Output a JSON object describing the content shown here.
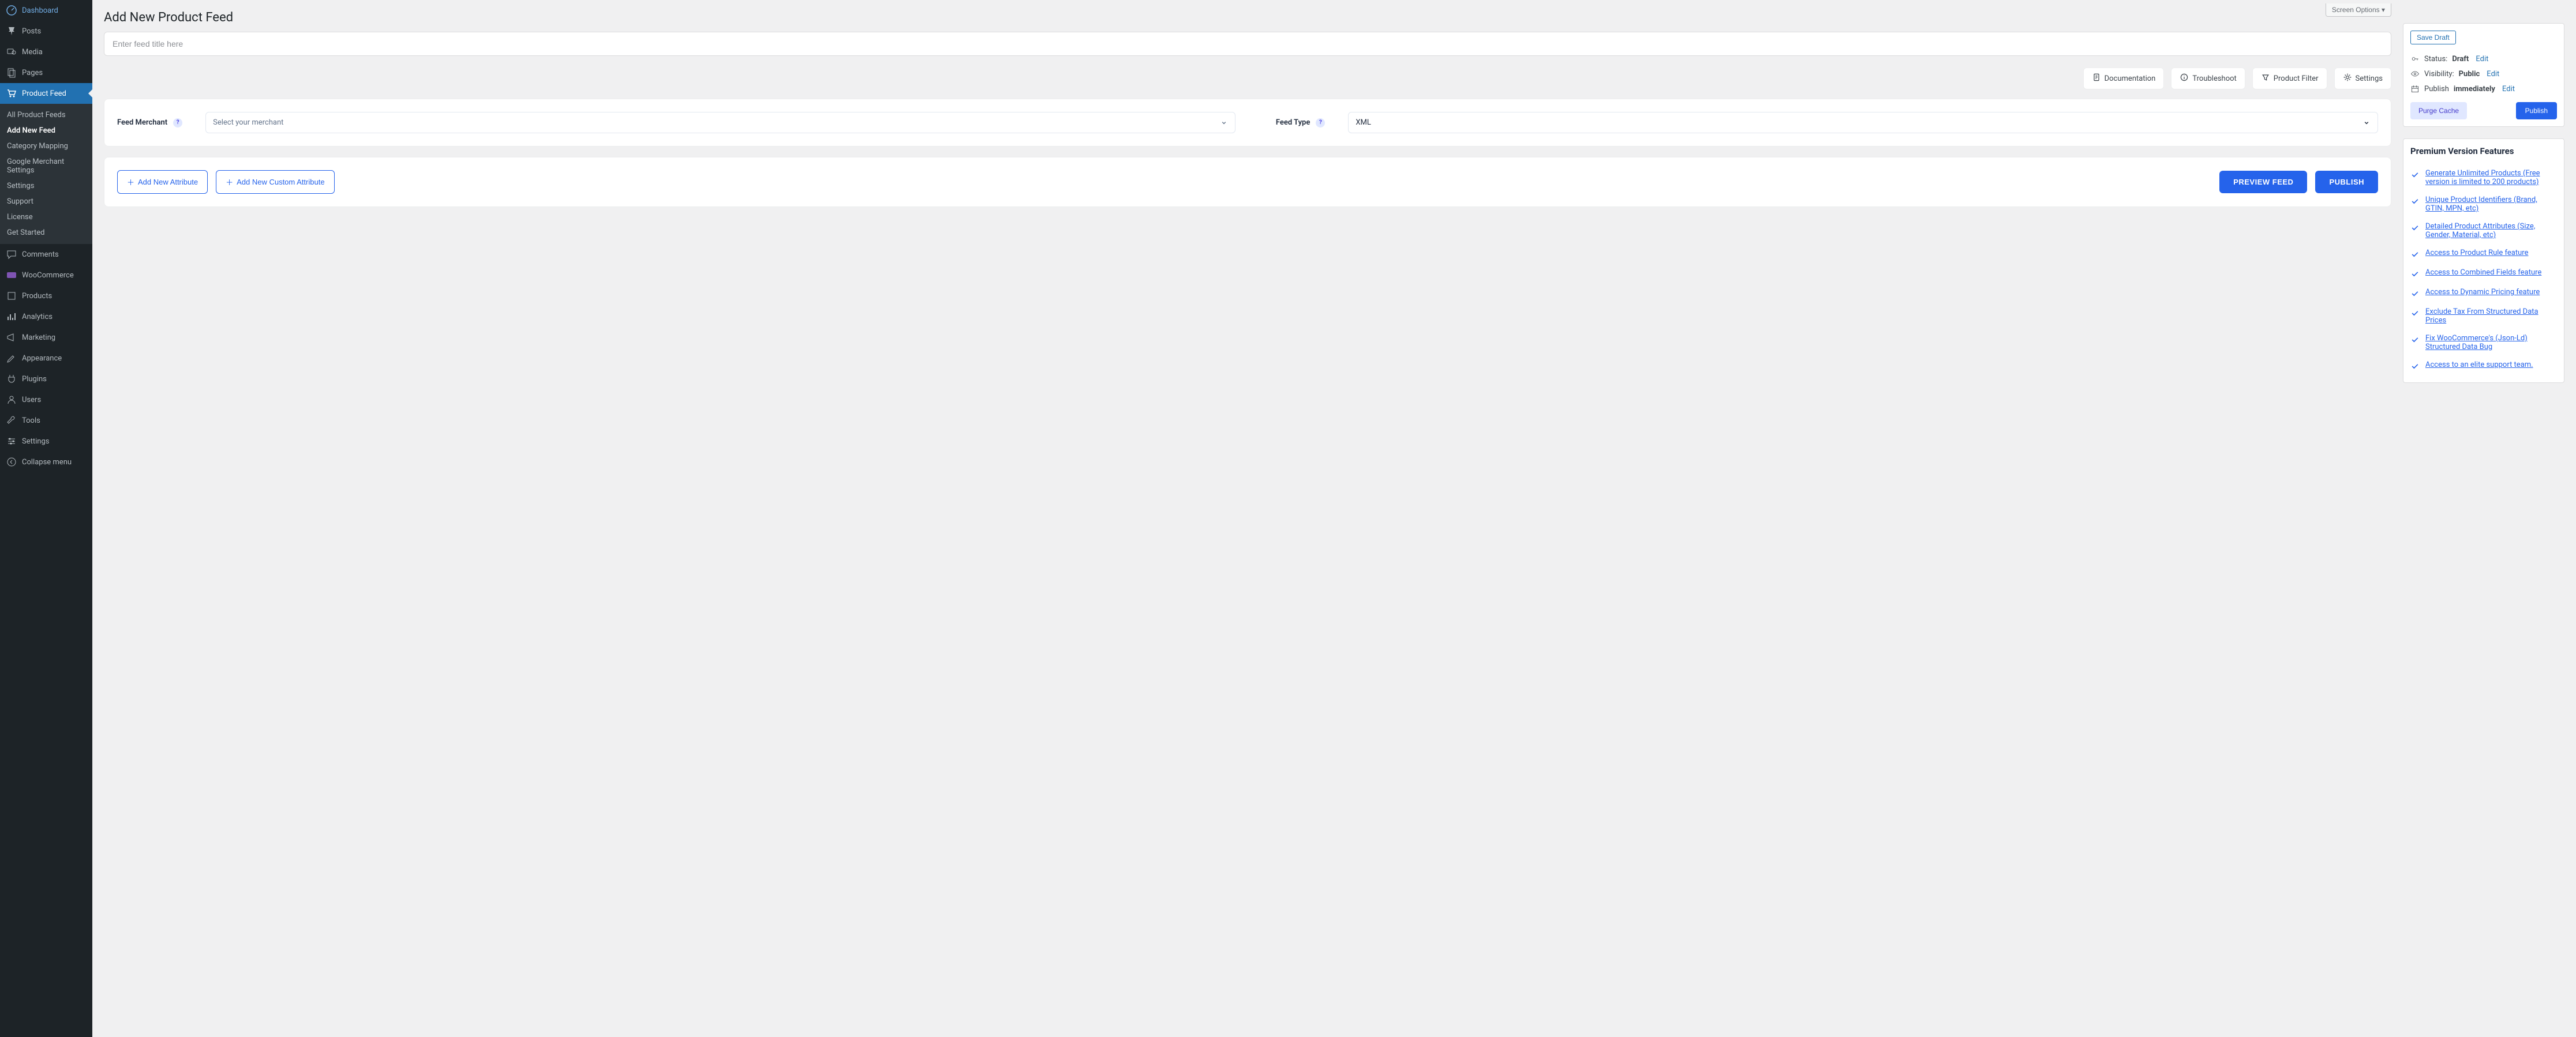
{
  "sidebar": {
    "items": [
      {
        "label": "Dashboard",
        "icon": "dashboard"
      },
      {
        "label": "Posts",
        "icon": "pin"
      },
      {
        "label": "Media",
        "icon": "media"
      },
      {
        "label": "Pages",
        "icon": "pages"
      },
      {
        "label": "Product Feed",
        "icon": "feed",
        "active": true
      },
      {
        "label": "Comments",
        "icon": "comments"
      },
      {
        "label": "WooCommerce",
        "icon": "woo"
      },
      {
        "label": "Products",
        "icon": "products"
      },
      {
        "label": "Analytics",
        "icon": "analytics"
      },
      {
        "label": "Marketing",
        "icon": "marketing"
      },
      {
        "label": "Appearance",
        "icon": "appearance"
      },
      {
        "label": "Plugins",
        "icon": "plugins"
      },
      {
        "label": "Users",
        "icon": "users"
      },
      {
        "label": "Tools",
        "icon": "tools"
      },
      {
        "label": "Settings",
        "icon": "settings"
      },
      {
        "label": "Collapse menu",
        "icon": "collapse"
      }
    ],
    "submenu": [
      {
        "label": "All Product Feeds"
      },
      {
        "label": "Add New Feed",
        "current": true
      },
      {
        "label": "Category Mapping"
      },
      {
        "label": "Google Merchant Settings"
      },
      {
        "label": "Settings"
      },
      {
        "label": "Support"
      },
      {
        "label": "License"
      },
      {
        "label": "Get Started"
      }
    ]
  },
  "header": {
    "title": "Add New Product Feed",
    "screen_options": "Screen Options"
  },
  "title_input": {
    "placeholder": "Enter feed title here",
    "value": ""
  },
  "action_bar": {
    "documentation": "Documentation",
    "troubleshoot": "Troubleshoot",
    "product_filter": "Product Filter",
    "settings": "Settings"
  },
  "form": {
    "feed_merchant_label": "Feed Merchant",
    "feed_merchant_placeholder": "Select your merchant",
    "feed_type_label": "Feed Type",
    "feed_type_value": "XML"
  },
  "buttons": {
    "add_attribute": "Add New Attribute",
    "add_custom_attribute": "Add New Custom Attribute",
    "preview": "PREVIEW FEED",
    "publish": "PUBLISH"
  },
  "publish_box": {
    "save_draft": "Save Draft",
    "status_label": "Status:",
    "status_value": "Draft",
    "visibility_label": "Visibility:",
    "visibility_value": "Public",
    "publish_label": "Publish",
    "publish_value": "immediately",
    "edit": "Edit",
    "purge_cache": "Purge Cache",
    "publish_btn": "Publish"
  },
  "premium": {
    "title": "Premium Version Features",
    "features": [
      "Generate Unlimited Products (Free version is limited to 200 products)",
      "Unique Product Identifiers (Brand, GTIN, MPN, etc)",
      "Detailed Product Attributes (Size, Gender, Material, etc)",
      "Access to Product Rule feature",
      "Access to Combined Fields feature",
      "Access to Dynamic Pricing feature",
      "Exclude Tax From Structured Data Prices",
      "Fix WooCommerce's (Json-Ld) Structured Data Bug",
      "Access to an elite support team."
    ]
  },
  "colors": {
    "primary": "#2563eb",
    "sidebar_bg": "#1d2327",
    "sidebar_active": "#2271b1"
  }
}
